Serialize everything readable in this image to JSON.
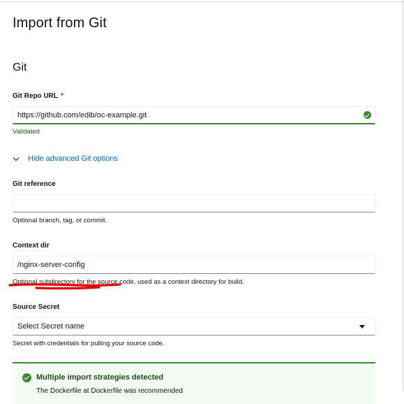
{
  "page": {
    "title": "Import from Git"
  },
  "git": {
    "section_title": "Git",
    "repo_url": {
      "label": "Git Repo URL",
      "required_marker": "*",
      "value": "https://github.com/edib/oc-example.git",
      "helper": "Validated"
    },
    "advanced_toggle": "Hide advanced Git options",
    "reference": {
      "label": "Git reference",
      "value": "",
      "helper": "Optional branch, tag, or commit."
    },
    "context_dir": {
      "label": "Context dir",
      "value": "/nginx-server-config",
      "helper": "Optional subdirectory for the source code, used as a context directory for build."
    },
    "source_secret": {
      "label": "Source Secret",
      "selected": "Select Secret name",
      "helper": "Secret with credentials for pulling your source code."
    }
  },
  "alert": {
    "title": "Multiple import strategies detected",
    "body": "The Dockerfile at Dockerfile was recommended"
  },
  "annotation": {
    "color": "#e00000"
  },
  "colors": {
    "success": "#3e8635",
    "link": "#0066cc",
    "required": "#c9190b"
  },
  "icons": {
    "validated": "check-circle-icon",
    "toggle": "chevron-down-icon",
    "select": "caret-down-icon",
    "alert": "check-circle-icon"
  }
}
